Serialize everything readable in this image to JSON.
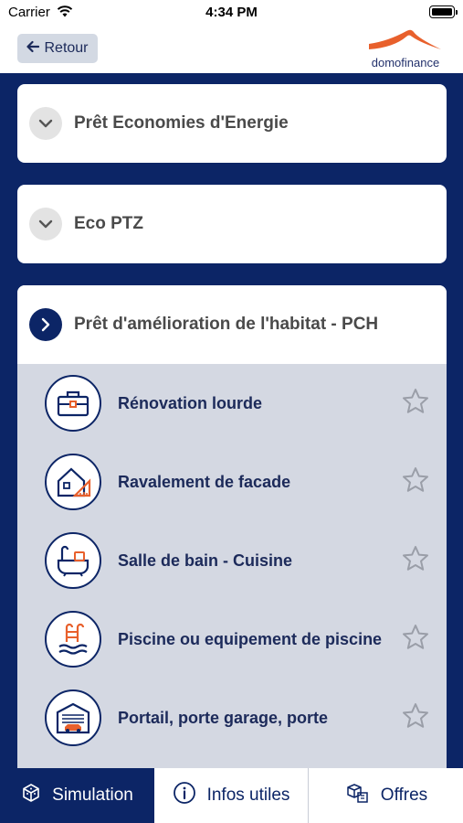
{
  "status_bar": {
    "carrier": "Carrier",
    "time": "4:34 PM"
  },
  "nav": {
    "back_label": "Retour",
    "logo_text": "domofinance"
  },
  "accordion": [
    {
      "label": "Prêt Economies d'Energie",
      "expanded": false
    },
    {
      "label": "Eco PTZ",
      "expanded": false
    },
    {
      "label": "Prêt d'amélioration de l'habitat - PCH",
      "expanded": true
    }
  ],
  "sub_items": [
    {
      "label": "Rénovation lourde",
      "icon": "toolbox-icon"
    },
    {
      "label": "Ravalement de facade",
      "icon": "house-ruler-icon"
    },
    {
      "label": "Salle de bain - Cuisine",
      "icon": "bathtub-icon"
    },
    {
      "label": "Piscine ou equipement de piscine",
      "icon": "pool-ladder-icon"
    },
    {
      "label": "Portail, porte garage, porte",
      "icon": "garage-icon"
    }
  ],
  "tabs": [
    {
      "label": "Simulation",
      "icon": "cube-icon",
      "active": true
    },
    {
      "label": "Infos utiles",
      "icon": "info-icon",
      "active": false
    },
    {
      "label": "Offres",
      "icon": "boxes-icon",
      "active": false
    }
  ],
  "colors": {
    "primary": "#0c2566",
    "accent": "#e8602c",
    "panel": "#d4d8e2"
  }
}
